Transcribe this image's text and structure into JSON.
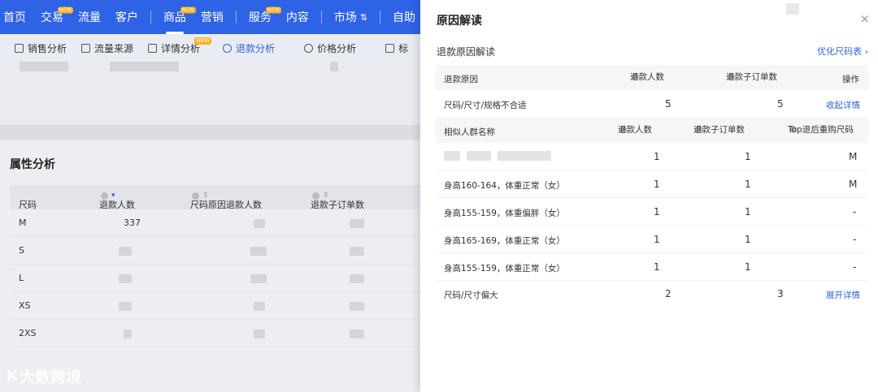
{
  "topnav": {
    "items": [
      {
        "label": "首页"
      },
      {
        "label": "交易",
        "badge": "NEW"
      },
      {
        "label": "流量"
      },
      {
        "label": "客户"
      },
      {
        "label": "商品",
        "badge": "NEW"
      },
      {
        "label": "营销"
      },
      {
        "label": "服务",
        "badge": "NEW"
      },
      {
        "label": "内容"
      },
      {
        "label": "市场"
      },
      {
        "label": "自助"
      }
    ]
  },
  "subtabs": [
    {
      "label": "销售分析"
    },
    {
      "label": "流量来源"
    },
    {
      "label": "详情分析",
      "badge": "NEW"
    },
    {
      "label": "退款分析"
    },
    {
      "label": "价格分析"
    },
    {
      "label": "标"
    }
  ],
  "attr": {
    "title": "属性分析",
    "headers": [
      "尺码",
      "退款人数",
      "尺码原因退款人数",
      "退款子订单数"
    ],
    "rows": [
      {
        "size": "M",
        "value": "337"
      },
      {
        "size": "S",
        "value": ""
      },
      {
        "size": "L",
        "value": ""
      },
      {
        "size": "XS",
        "value": ""
      },
      {
        "size": "2XS",
        "value": ""
      }
    ]
  },
  "logo": {
    "mark": "K",
    "text": "大数跨境"
  },
  "panel": {
    "title": "原因解读",
    "close": "×",
    "section_title": "退款原因解读",
    "optimize_link": "优化尺码表",
    "table_headers": [
      "退款原因",
      "退款人数",
      "退款子订单数",
      "操作"
    ],
    "reason1": {
      "name": "尺码/尺寸/规格不合适",
      "people": "5",
      "orders": "5",
      "action": "收起详情"
    },
    "sub_headers": [
      "相似人群名称",
      "退款人数",
      "退款子订单数",
      "Top退后重购尺码"
    ],
    "sub_rows": [
      {
        "name": "",
        "people": "1",
        "orders": "1",
        "size": "M"
      },
      {
        "name": "身高160-164，体重正常（女）",
        "people": "1",
        "orders": "1",
        "size": "M"
      },
      {
        "name": "身高155-159，体重偏胖（女）",
        "people": "1",
        "orders": "1",
        "size": "-"
      },
      {
        "name": "身高165-169，体重正常（女）",
        "people": "1",
        "orders": "1",
        "size": "-"
      },
      {
        "name": "身高155-159，体重正常（女）",
        "people": "1",
        "orders": "1",
        "size": "-"
      }
    ],
    "reason2": {
      "name": "尺码/尺寸偏大",
      "people": "2",
      "orders": "3",
      "action": "展开详情"
    }
  }
}
